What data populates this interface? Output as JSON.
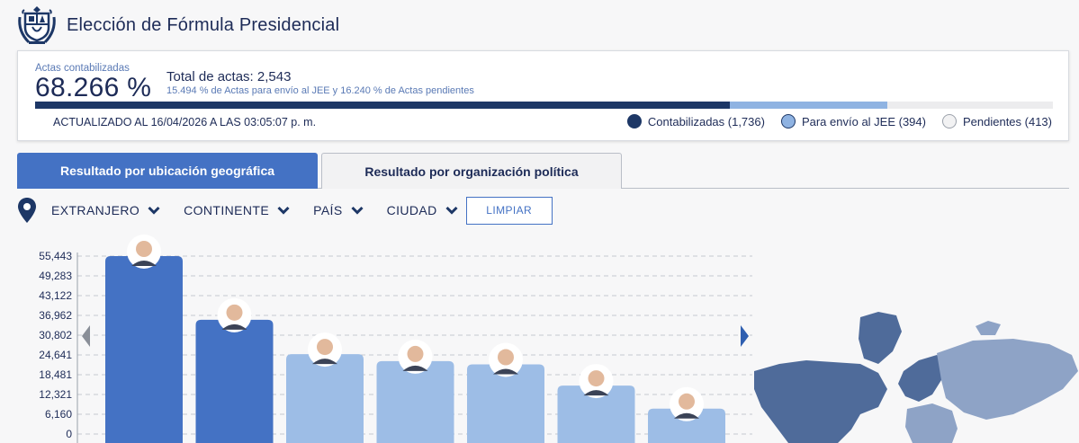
{
  "header": {
    "title": "Elección de Fórmula Presidencial"
  },
  "summary": {
    "actas_label": "Actas contabilizadas",
    "actas_pct": "68.266 %",
    "total_actas": "Total de actas: 2,543",
    "subtitle": "15.494 % de Actas para envío al JEE y 16.240 % de Actas pendientes",
    "updated": "ACTUALIZADO AL 16/04/2026 A LAS 03:05:07 p. m.",
    "progress": {
      "contabilizadas_pct": 68.266,
      "jee_pct": 15.494,
      "pendientes_pct": 16.24
    },
    "legend": [
      {
        "label": "Contabilizadas (1,736)",
        "color": "#1d3766"
      },
      {
        "label": "Para envío al JEE (394)",
        "color": "#8fb3e2"
      },
      {
        "label": "Pendientes (413)",
        "color": "#f2f2f3"
      }
    ]
  },
  "tabs": [
    {
      "label": "Resultado por ubicación geográfica",
      "active": true
    },
    {
      "label": "Resultado por organización política",
      "active": false
    }
  ],
  "filters": {
    "items": [
      "EXTRANJERO",
      "CONTINENTE",
      "PAÍS",
      "CIUDAD"
    ],
    "clear_label": "LIMPIAR",
    "icon": "location-pin-icon"
  },
  "colors": {
    "primary": "#4472c4",
    "light_bar": "#9dbde6",
    "dark": "#1d3766"
  },
  "chart_data": {
    "type": "bar",
    "categories": [
      "",
      "",
      "",
      "",
      "",
      "",
      ""
    ],
    "values": [
      55443,
      35600,
      24900,
      22700,
      21700,
      15100,
      7900
    ],
    "highlight": [
      true,
      true,
      false,
      false,
      false,
      false,
      false
    ],
    "yticks": [
      "0",
      "6,160",
      "12,321",
      "18,481",
      "24,641",
      "30,802",
      "36,962",
      "43,122",
      "49,283",
      "55,443"
    ],
    "ylim": [
      0,
      55443
    ],
    "grid": true,
    "title": "",
    "xlabel": "",
    "ylabel": ""
  }
}
